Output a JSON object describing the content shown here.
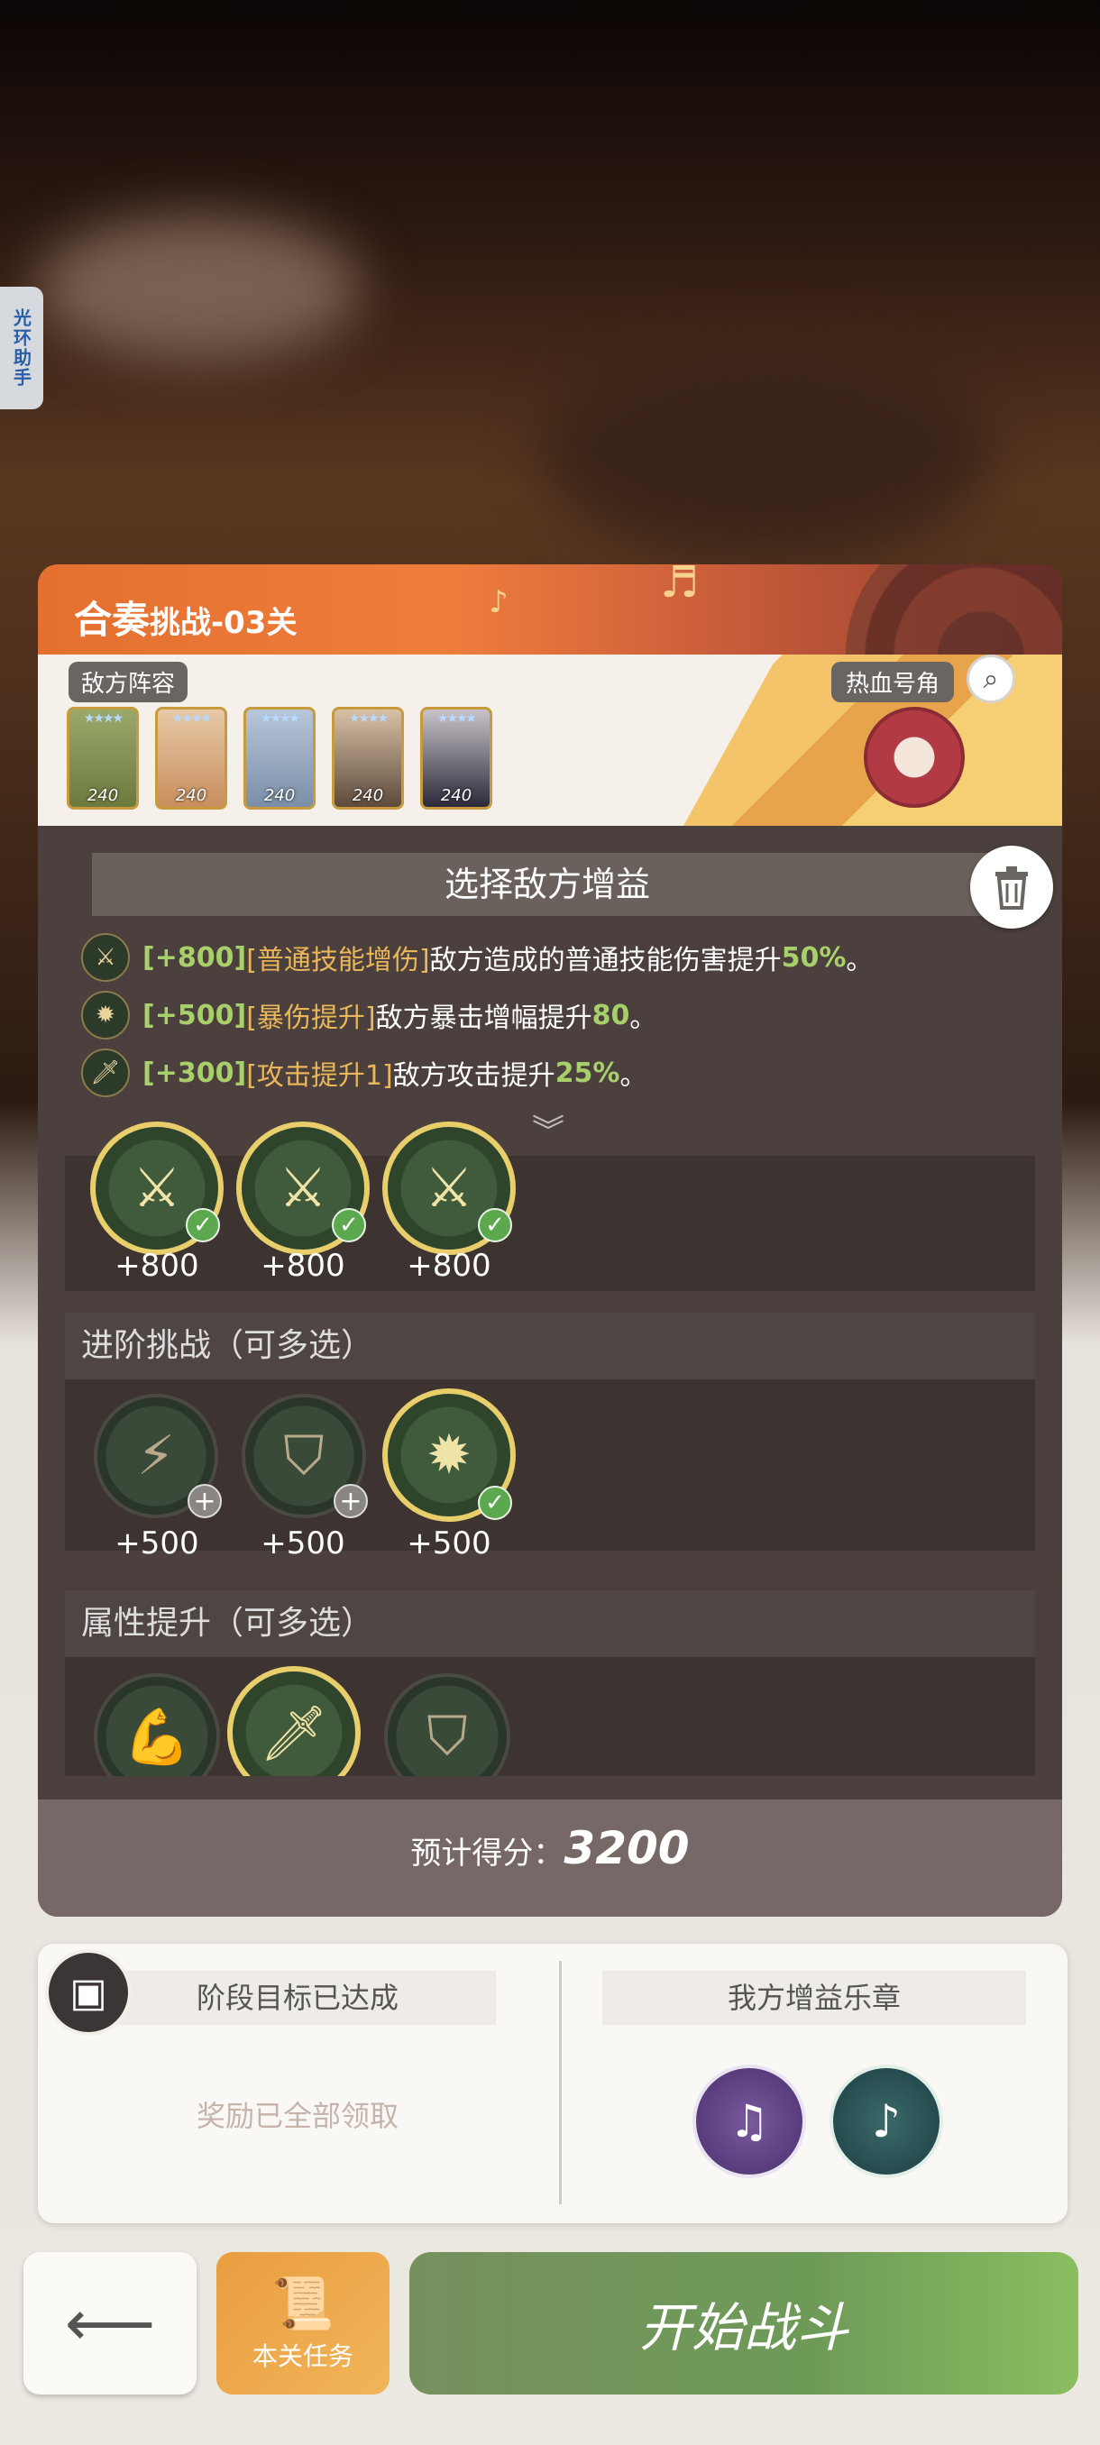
{
  "side_tab": {
    "label": "光环助手"
  },
  "header": {
    "title_main": "合奏",
    "title_sub": "挑战-03关"
  },
  "lineup": {
    "label": "敌方阵容",
    "cards": [
      {
        "level": "240"
      },
      {
        "level": "240"
      },
      {
        "level": "240"
      },
      {
        "level": "240"
      },
      {
        "level": "240"
      }
    ],
    "buff_item_label": "热血号角"
  },
  "buffs": {
    "title": "选择敌方增益",
    "rows": [
      {
        "score": "[+800]",
        "name": "[普通技能增伤]",
        "desc": "敌方造成的普通技能伤害提升",
        "value": "50%",
        "end": "。"
      },
      {
        "score": "[+500]",
        "name": "[暴伤提升]",
        "desc": "敌方暴击增幅提升",
        "value": "80",
        "end": "。"
      },
      {
        "score": "[+300]",
        "name": "[攻击提升1]",
        "desc": "敌方攻击提升",
        "value": "25%",
        "end": "。"
      }
    ]
  },
  "sections": {
    "first": {
      "values": [
        "+800",
        "+800",
        "+800"
      ]
    },
    "advanced": {
      "title": "进阶挑战（可多选）",
      "values": [
        "+500",
        "+500",
        "+500"
      ]
    },
    "attribute": {
      "title": "属性提升（可多选）"
    }
  },
  "score": {
    "label": "预计得分：",
    "value": "3200"
  },
  "stage": {
    "title": "阶段目标已达成",
    "subtitle": "奖励已全部领取"
  },
  "my_buffs": {
    "title": "我方增益乐章"
  },
  "buttons": {
    "task": "本关任务",
    "start": "开始战斗"
  },
  "colors": {
    "accent_orange": "#f07d3c",
    "start_green": "#6e9a58",
    "task_orange": "#e99d3f"
  }
}
